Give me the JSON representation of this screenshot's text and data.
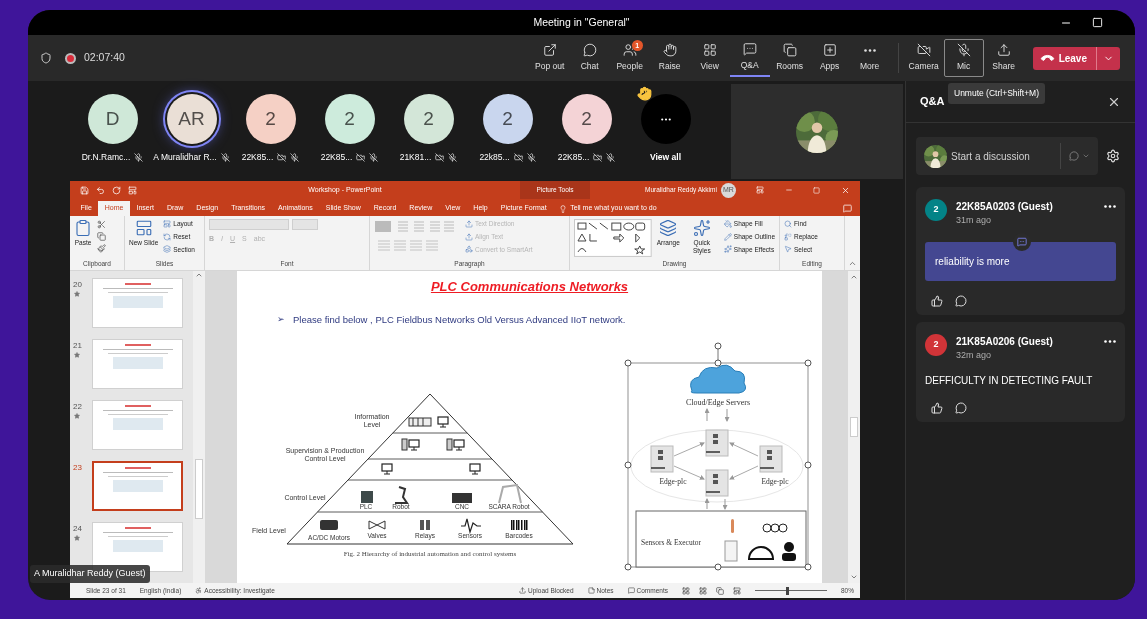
{
  "window": {
    "title": "Meeting in \"General\""
  },
  "meeting_bar": {
    "recording": true,
    "timer": "02:07:40",
    "controls": [
      {
        "kind": "popout",
        "label": "Pop out",
        "selected": false,
        "hovered": false
      },
      {
        "kind": "chat",
        "label": "Chat",
        "selected": false,
        "hovered": false
      },
      {
        "kind": "people",
        "label": "People",
        "selected": false,
        "hovered": false,
        "badge": "1"
      },
      {
        "kind": "raise",
        "label": "Raise",
        "selected": false,
        "hovered": false
      },
      {
        "kind": "view",
        "label": "View",
        "selected": false,
        "hovered": false
      },
      {
        "kind": "qa",
        "label": "Q&A",
        "selected": true,
        "hovered": false
      },
      {
        "kind": "rooms",
        "label": "Rooms",
        "selected": false,
        "hovered": false
      },
      {
        "kind": "apps",
        "label": "Apps",
        "selected": false,
        "hovered": false
      },
      {
        "kind": "more",
        "label": "More",
        "selected": false,
        "hovered": false
      }
    ],
    "device_controls": [
      {
        "kind": "camera",
        "label": "Camera",
        "selected": false,
        "hovered": false
      },
      {
        "kind": "mic",
        "label": "Mic",
        "selected": false,
        "hovered": true
      },
      {
        "kind": "share",
        "label": "Share",
        "selected": false,
        "hovered": false
      }
    ],
    "leave_button": {
      "label": "Leave"
    },
    "tooltip": "Unmute (Ctrl+Shift+M)"
  },
  "participants": [
    {
      "initials": "D",
      "name": "Dr.N.Ramc...",
      "color": "#cfe8d8",
      "speaking": false,
      "camera_off": false
    },
    {
      "initials": "AR",
      "name": "A Muralidhar R...",
      "color": "#eadfd6",
      "speaking": true,
      "camera_off": false
    },
    {
      "initials": "2",
      "name": "22K85...",
      "color": "#f5d0c5",
      "speaking": false,
      "camera_off": true
    },
    {
      "initials": "2",
      "name": "22K85...",
      "color": "#cdebdc",
      "speaking": false,
      "camera_off": true
    },
    {
      "initials": "2",
      "name": "21K81...",
      "color": "#d3e6d8",
      "speaking": false,
      "camera_off": true
    },
    {
      "initials": "2",
      "name": "22k85...",
      "color": "#c9d6ee",
      "speaking": false,
      "camera_off": true
    },
    {
      "initials": "2",
      "name": "22K85...",
      "color": "#f4d3d6",
      "speaking": false,
      "camera_off": true
    }
  ],
  "overflow": {
    "label": "View all",
    "hand_raised": true
  },
  "presentation": {
    "title": "Workshop - PowerPoint",
    "context_tab": "Picture Tools",
    "user": "Muralidhar Reddy Akkimi",
    "user_initials": "MR",
    "tabs": [
      {
        "label": "File",
        "selected": false
      },
      {
        "label": "Home",
        "selected": true
      },
      {
        "label": "Insert",
        "selected": false
      },
      {
        "label": "Draw",
        "selected": false
      },
      {
        "label": "Design",
        "selected": false
      },
      {
        "label": "Transitions",
        "selected": false
      },
      {
        "label": "Animations",
        "selected": false
      },
      {
        "label": "Slide Show",
        "selected": false
      },
      {
        "label": "Record",
        "selected": false
      },
      {
        "label": "Review",
        "selected": false
      },
      {
        "label": "View",
        "selected": false
      },
      {
        "label": "Help",
        "selected": false
      },
      {
        "label": "Picture Format",
        "selected": false
      }
    ],
    "tell_me": "Tell me what you want to do",
    "ribbon": [
      {
        "label": "Clipboard",
        "items": [
          {
            "kind": "large",
            "label": "Paste",
            "disabled": false
          }
        ]
      },
      {
        "label": "Slides",
        "items": [
          {
            "kind": "large",
            "label": "New Slide",
            "disabled": false
          },
          {
            "kind": "small",
            "label": "Layout",
            "disabled": false
          },
          {
            "kind": "small",
            "label": "Reset",
            "disabled": false
          },
          {
            "kind": "small",
            "label": "Section",
            "disabled": false
          }
        ]
      },
      {
        "label": "Font",
        "items": [
          {
            "kind": "glyph",
            "label": "B",
            "disabled": true
          },
          {
            "kind": "glyph",
            "label": "I",
            "disabled": true
          },
          {
            "kind": "glyph",
            "label": "U",
            "disabled": true
          },
          {
            "kind": "glyph",
            "label": "S",
            "disabled": true
          },
          {
            "kind": "glyph",
            "label": "abc",
            "disabled": true
          }
        ]
      },
      {
        "label": "Paragraph",
        "items": [
          {
            "kind": "small",
            "label": "Text Direction",
            "disabled": true
          },
          {
            "kind": "small",
            "label": "Align Text",
            "disabled": true
          },
          {
            "kind": "small",
            "label": "Convert to SmartArt",
            "disabled": true
          }
        ]
      },
      {
        "label": "Drawing",
        "items": [
          {
            "kind": "large",
            "label": "Arrange",
            "disabled": false
          },
          {
            "kind": "large",
            "label": "Quick Styles",
            "disabled": false
          },
          {
            "kind": "small",
            "label": "Shape Fill",
            "disabled": false
          },
          {
            "kind": "small",
            "label": "Shape Outline",
            "disabled": false
          },
          {
            "kind": "small",
            "label": "Shape Effects",
            "disabled": false
          }
        ]
      },
      {
        "label": "Editing",
        "items": [
          {
            "kind": "small",
            "label": "Find",
            "disabled": false
          },
          {
            "kind": "small",
            "label": "Replace",
            "disabled": false
          },
          {
            "kind": "small",
            "label": "Select",
            "disabled": false
          }
        ]
      }
    ],
    "thumbnails": [
      {
        "number": "20",
        "selected": false
      },
      {
        "number": "21",
        "selected": false
      },
      {
        "number": "22",
        "selected": false
      },
      {
        "number": "23",
        "selected": true
      },
      {
        "number": "24",
        "selected": false
      }
    ],
    "slide": {
      "title": "PLC Communications Networks",
      "bullet_marker": "➢",
      "bullet": "Please find below , PLC Fieldbus Networks Old Versus Advanced IIoT network.",
      "pyramid": {
        "levels": [
          {
            "lines": [
              "Information",
              "Level"
            ]
          },
          {
            "lines": [
              "Supervision & Production",
              "Control Level"
            ]
          },
          {
            "lines": [
              "Control Level"
            ]
          },
          {
            "lines": [
              "Field Level"
            ]
          }
        ],
        "devices": [
          {
            "label": "PLC"
          },
          {
            "label": "Robot"
          },
          {
            "label": "CNC"
          },
          {
            "label": "SCARA Robot"
          },
          {
            "label": "AC/DC Motors"
          },
          {
            "label": "Valves"
          },
          {
            "label": "Relays"
          },
          {
            "label": "Sensors"
          },
          {
            "label": "Barcodes"
          }
        ],
        "caption": "Fig. 2 Hierarchy of industrial automation and control systems"
      },
      "iot": {
        "selected": true,
        "cloud_label": "Cloud/Edge Servers",
        "edge_labels": [
          "Edge-plc",
          "Edge-plc"
        ],
        "sensors_label": "Sensors & Executor"
      }
    },
    "status": {
      "slide_info": "Slide 23 of 31",
      "language": "English (India)",
      "accessibility": "Accessibility: Investigate",
      "upload": "Upload Blocked",
      "notes": "Notes",
      "comments": "Comments",
      "zoom": "80%",
      "level": 0.43
    }
  },
  "presenter_tag": "A Muralidhar Reddy (Guest)",
  "qa_panel": {
    "title": "Q&A",
    "compose_placeholder": "Start a discussion",
    "posts": [
      {
        "initials": "2",
        "color": "#038387",
        "author": "22K85A0203 (Guest)",
        "time": "31m ago",
        "text": "reliability is more",
        "highlighted": true
      },
      {
        "initials": "2",
        "color": "#d13438",
        "author": "21K85A0206 (Guest)",
        "time": "32m ago",
        "text": "DEFFICULTY IN DETECTING FAULT",
        "highlighted": false
      }
    ]
  }
}
